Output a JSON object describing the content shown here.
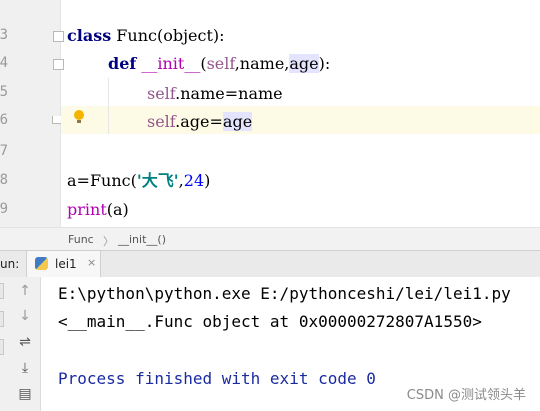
{
  "editor": {
    "line_numbers": [
      "3",
      "4",
      "5",
      "6",
      "7",
      "8",
      "9"
    ],
    "lines": {
      "l1": {
        "kw": "class",
        "rest": " Func(object):"
      },
      "l2": {
        "kw": "def",
        "name": "__init__",
        "open": "(",
        "self": "self",
        "mid": ",name,",
        "arg": "age",
        "close": "):"
      },
      "l3": {
        "self": "self",
        "rest": ".name=name"
      },
      "l4": {
        "self": "self",
        "mid": ".age=",
        "arg": "age"
      },
      "l6": {
        "pre": "a=Func(",
        "str": "'大飞'",
        "comma": ",",
        "num": "24",
        "close": ")"
      },
      "l7": {
        "fn": "print",
        "rest": "(a)"
      }
    }
  },
  "breadcrumb": {
    "items": [
      "Func",
      "__init__()"
    ],
    "separator": "〉"
  },
  "run_panel": {
    "label": "un:",
    "tab_label": "lei1",
    "close_glyph": "×",
    "toolbar_icons": [
      "up-arrow-icon",
      "down-arrow-icon",
      "soft-wrap-icon",
      "scroll-to-end-icon",
      "print-icon"
    ]
  },
  "console": {
    "command": "E:\\python\\python.exe E:/pythonceshi/lei/lei1.py",
    "output": "<__main__.Func object at 0x00000272807A1550>",
    "exit_message": "Process finished with exit code 0"
  },
  "watermark": "CSDN @测试领头羊",
  "colors": {
    "keyword": "#000080",
    "self": "#94558d",
    "string": "#008080",
    "number": "#0000ff",
    "builtin": "#b200b2",
    "exit_text": "#1a2ba0"
  }
}
